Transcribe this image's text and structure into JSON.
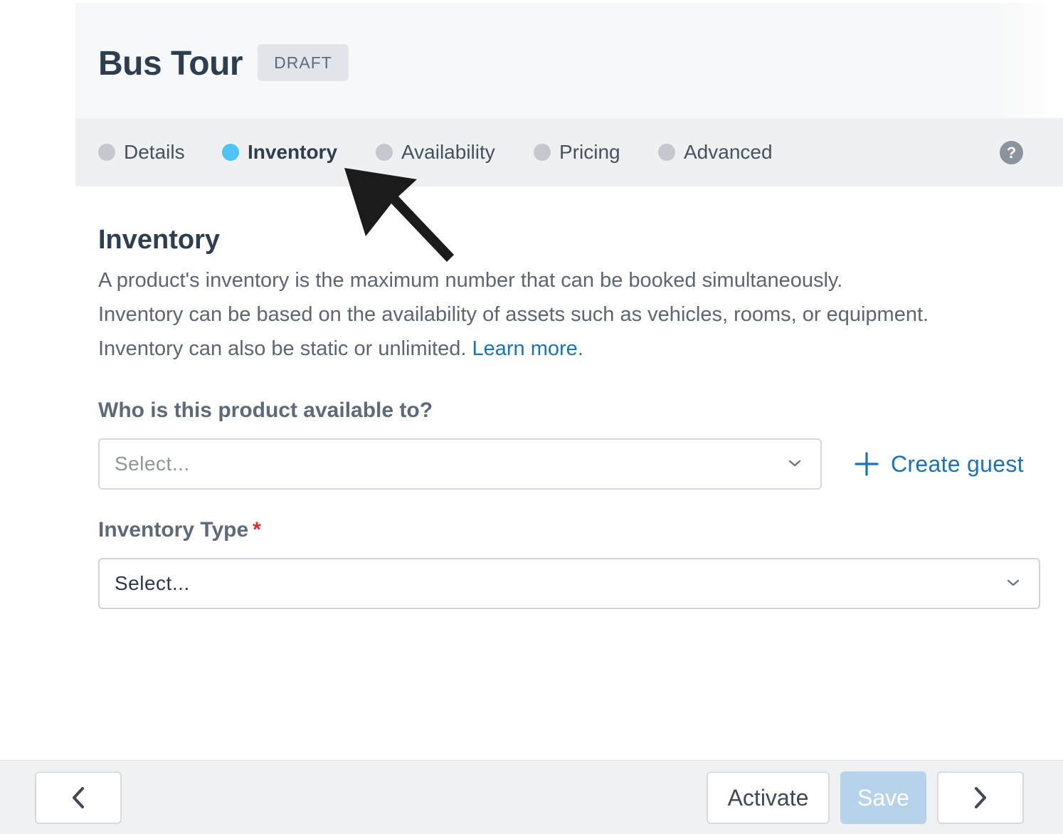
{
  "header": {
    "title": "Bus Tour",
    "status_badge": "DRAFT"
  },
  "tabs": [
    {
      "label": "Details",
      "state": "inactive"
    },
    {
      "label": "Inventory",
      "state": "active"
    },
    {
      "label": "Availability",
      "state": "inactive"
    },
    {
      "label": "Pricing",
      "state": "inactive"
    },
    {
      "label": "Advanced",
      "state": "inactive"
    }
  ],
  "help": {
    "icon": "question-circle-icon",
    "glyph": "?"
  },
  "annotation": {
    "icon": "pointer-arrow-icon"
  },
  "section": {
    "title": "Inventory",
    "description_lines": [
      "A product's inventory is the maximum number that can be booked simultaneously.",
      "Inventory can be based on the availability of assets such as vehicles, rooms, or equipment.",
      "Inventory can also be static or unlimited."
    ],
    "learn_more": "Learn more",
    "learn_more_suffix": "."
  },
  "availability_field": {
    "label": "Who is this product available to?",
    "placeholder": "Select...",
    "create_guest_label": "Create guest"
  },
  "inventory_type_field": {
    "label": "Inventory Type",
    "required_mark": "*",
    "value": "Select..."
  },
  "footer": {
    "activate_label": "Activate",
    "save_label": "Save",
    "save_disabled": true
  },
  "colors": {
    "accent": "#1a73b8",
    "active_tab_dot": "#4fc3f7",
    "inactive_tab_dot": "#c4c8ce",
    "required": "#d93025",
    "disabled_save": "#b7d3ec"
  }
}
